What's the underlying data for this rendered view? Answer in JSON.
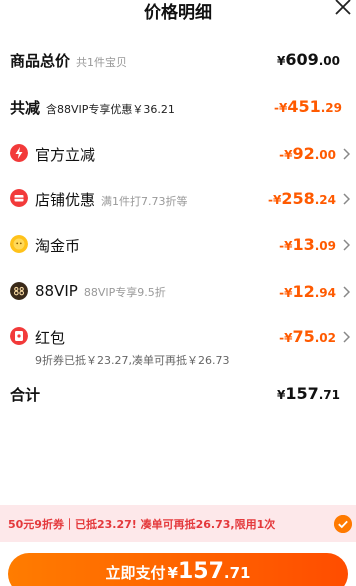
{
  "header": {
    "title": "价格明细"
  },
  "total_goods": {
    "label": "商品总价",
    "sub": "共1件宝贝",
    "yen": "¥",
    "int": "609",
    "dec": ".00"
  },
  "reduction": {
    "label": "共减",
    "sub": "含88VIP专享优惠￥36.21",
    "yen": "-¥",
    "int": "451",
    "dec": ".29"
  },
  "items": [
    {
      "label": "官方立减",
      "sub": "",
      "yen": "-¥",
      "int": "92",
      "dec": ".00",
      "icon": "lightning-icon"
    },
    {
      "label": "店铺优惠",
      "sub": "满1件打7.73折等",
      "yen": "-¥",
      "int": "258",
      "dec": ".24",
      "icon": "shop-icon"
    },
    {
      "label": "淘金币",
      "sub": "",
      "yen": "-¥",
      "int": "13",
      "dec": ".09",
      "icon": "gold-coin-icon"
    },
    {
      "label": "88VIP",
      "sub": "88VIP专享9.5折",
      "yen": "-¥",
      "int": "12",
      "dec": ".94",
      "icon": "vip-88-icon"
    },
    {
      "label": "红包",
      "sub": "",
      "yen": "-¥",
      "int": "75",
      "dec": ".02",
      "icon": "red-packet-icon",
      "note": "9折券已抵￥23.27,凑单可再抵￥26.73"
    }
  ],
  "total": {
    "label": "合计",
    "yen": "¥",
    "int": "157",
    "dec": ".71"
  },
  "banner": {
    "text": "50元9折券｜已抵23.27! 凑单可再抵26.73,限用1次"
  },
  "pay_button": {
    "label": "立即支付",
    "yen": "¥",
    "int": "157",
    "dec": ".71"
  },
  "colors": {
    "accent": "#ff5a00",
    "banner_bg": "#fde8ea",
    "banner_text": "#e4393c"
  }
}
